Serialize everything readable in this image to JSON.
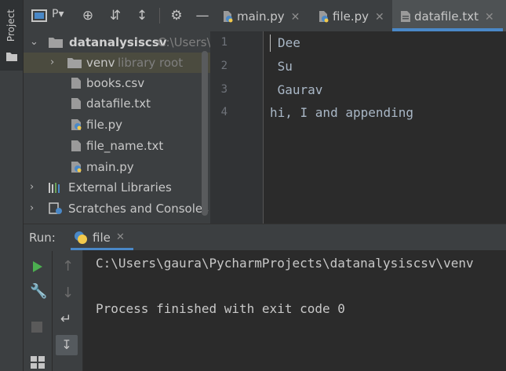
{
  "stripe": {
    "project_label": "Project"
  },
  "toolbar": {
    "view_label": "P▾"
  },
  "tabs": [
    {
      "label": "main.py"
    },
    {
      "label": "file.py"
    },
    {
      "label": "datafile.txt"
    }
  ],
  "tree": {
    "root": {
      "name": "datanalysiscsv",
      "path": "C:\\Users\\g"
    },
    "venv": {
      "name": "venv",
      "hint": "library root"
    },
    "files": [
      "books.csv",
      "datafile.txt",
      "file.py",
      "file_name.txt",
      "main.py"
    ],
    "external": "External Libraries",
    "scratches": "Scratches and Consoles"
  },
  "editor": {
    "line_numbers": [
      "1",
      "2",
      "3",
      "4"
    ],
    "lines": [
      "Dee",
      " Su",
      " Gaurav",
      "hi, I and appending"
    ]
  },
  "run": {
    "label": "Run:",
    "tab": "file",
    "output": [
      "C:\\Users\\gaura\\PycharmProjects\\datanalysiscsv\\venv",
      "Process finished with exit code 0"
    ]
  },
  "colors": {
    "python_blue": "#4a88c7",
    "python_yellow": "#f2c94c",
    "run_green": "#4caf50"
  }
}
